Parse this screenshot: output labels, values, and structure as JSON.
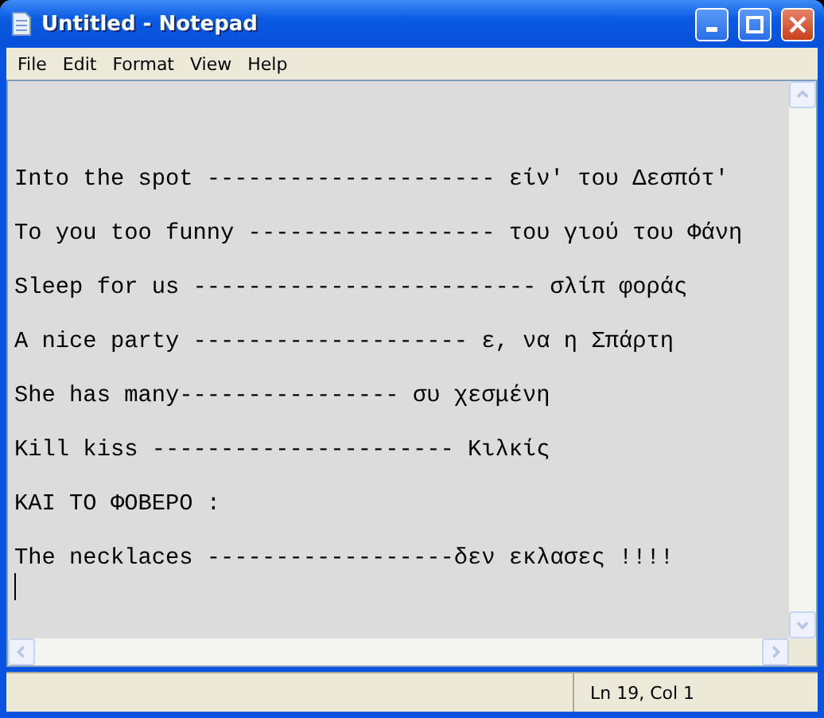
{
  "window": {
    "title": "Untitled - Notepad"
  },
  "menu": [
    "File",
    "Edit",
    "Format",
    "View",
    "Help"
  ],
  "document": {
    "lines": [
      {
        "text": "Into the spot --------------------- είν' του Δεσπότ'"
      },
      {
        "text": "To you too funny ------------------ του γιού του Φάνη"
      },
      {
        "text": "Sleep for us ------------------------- σλίπ φοράς"
      },
      {
        "text": "A nice party -------------------- ε, να η Σπάρτη"
      },
      {
        "text": "She has many---------------- συ χεσμένη"
      },
      {
        "text": "Kill kiss ---------------------- Κιλκίς"
      },
      {
        "text": "ΚΑΙ ΤΟ ΦΟΒΕΡΟ :"
      },
      {
        "text": "The necklaces ------------------δεν εκλασες !!!!"
      }
    ]
  },
  "status_bar": {
    "position": "Ln 19, Col 1"
  }
}
